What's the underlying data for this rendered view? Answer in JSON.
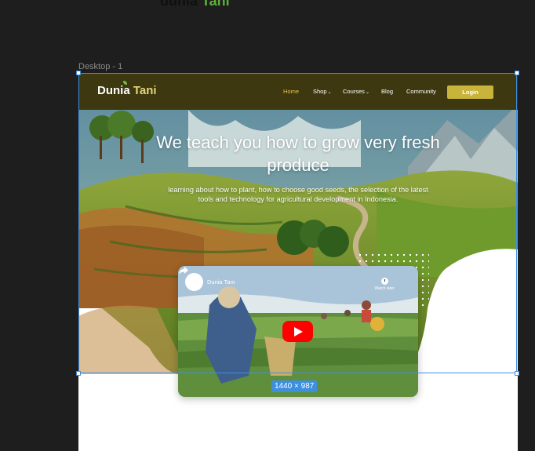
{
  "canvas": {
    "top_label_a": "dunia ",
    "top_label_b": "Tani",
    "frame_name": "Desktop - 1",
    "size_badge": "1440 × 987"
  },
  "site": {
    "logo_a": "Dunia ",
    "logo_b": "Tani",
    "nav": [
      {
        "label": "Home",
        "active": true,
        "dropdown": false
      },
      {
        "label": "Shop",
        "active": false,
        "dropdown": true
      },
      {
        "label": "Courses",
        "active": false,
        "dropdown": true
      },
      {
        "label": "Blog",
        "active": false,
        "dropdown": false
      },
      {
        "label": "Community",
        "active": false,
        "dropdown": false
      }
    ],
    "login_label": "Login",
    "hero_title": "We teach you how to grow very fresh produce",
    "hero_subtitle": "learning about how to plant, how to choose good seeds, the selection of the latest tools and technology for agricultural development in Indonesia.",
    "video": {
      "channel_title": "Dunia Tani",
      "watch_later_label": "Watch later"
    }
  },
  "icons": {
    "dropdown": "chevron-down-icon",
    "play": "youtube-play-icon",
    "clock": "clock-icon",
    "share": "share-icon"
  },
  "colors": {
    "navbar": "#3d3810",
    "accent": "#c8b43a",
    "active_nav": "#e8c84a",
    "selection": "#3d8fe0",
    "canvas_bg": "#1e1e1e"
  }
}
